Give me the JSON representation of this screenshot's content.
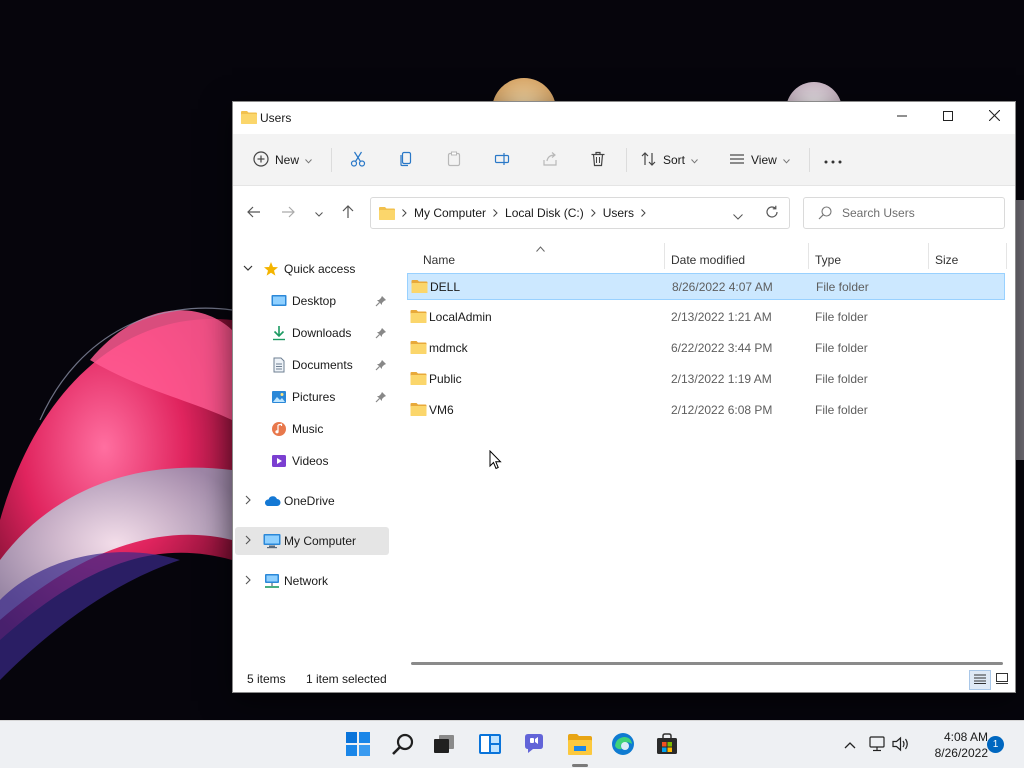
{
  "window": {
    "title": "Users",
    "minimize_icon": "minimize-icon",
    "maximize_icon": "maximize-icon",
    "close_icon": "close-icon"
  },
  "toolbar": {
    "new_label": "New",
    "sort_label": "Sort",
    "view_label": "View",
    "buttons": [
      "cut-icon",
      "copy-icon",
      "paste-icon",
      "rename-icon",
      "share-icon",
      "delete-icon",
      "more-icon"
    ]
  },
  "navigation": {
    "back_icon": "arrow-left-icon",
    "forward_icon": "arrow-right-icon",
    "recent_icon": "chevron-down-icon",
    "up_icon": "arrow-up-icon",
    "breadcrumb": [
      "My Computer",
      "Local Disk (C:)",
      "Users"
    ],
    "search_placeholder": "Search Users"
  },
  "sidebar": {
    "quick_access": "Quick access",
    "items": [
      {
        "label": "Desktop",
        "icon": "desktop-icon",
        "pinned": true
      },
      {
        "label": "Downloads",
        "icon": "download-icon",
        "pinned": true
      },
      {
        "label": "Documents",
        "icon": "document-icon",
        "pinned": true
      },
      {
        "label": "Pictures",
        "icon": "pictures-icon",
        "pinned": true
      },
      {
        "label": "Music",
        "icon": "music-icon",
        "pinned": false
      },
      {
        "label": "Videos",
        "icon": "video-icon",
        "pinned": false
      }
    ],
    "onedrive": "OneDrive",
    "my_computer": "My Computer",
    "network": "Network"
  },
  "columns": {
    "name": "Name",
    "date": "Date modified",
    "type": "Type",
    "size": "Size"
  },
  "files": [
    {
      "name": "DELL",
      "date": "8/26/2022 4:07 AM",
      "type": "File folder",
      "selected": true
    },
    {
      "name": "LocalAdmin",
      "date": "2/13/2022 1:21 AM",
      "type": "File folder",
      "selected": false
    },
    {
      "name": "mdmck",
      "date": "6/22/2022 3:44 PM",
      "type": "File folder",
      "selected": false
    },
    {
      "name": "Public",
      "date": "2/13/2022 1:19 AM",
      "type": "File folder",
      "selected": false
    },
    {
      "name": "VM6",
      "date": "2/12/2022 6:08 PM",
      "type": "File folder",
      "selected": false
    }
  ],
  "status": {
    "items": "5 items",
    "selected": "1 item selected"
  },
  "taskbar": {
    "icons": [
      "start-icon",
      "search-icon",
      "task-view-icon",
      "widgets-icon",
      "chat-icon",
      "file-explorer-icon",
      "edge-icon",
      "store-icon"
    ],
    "tray": [
      "chevron-up-icon",
      "network-icon",
      "volume-icon"
    ],
    "time": "4:08 AM",
    "date": "8/26/2022",
    "notifications": "1"
  },
  "colors": {
    "accent": "#0067c0",
    "selection": "#cce8ff",
    "folder": "#f2c14e",
    "toolbar_bg": "#f3f3f3"
  }
}
